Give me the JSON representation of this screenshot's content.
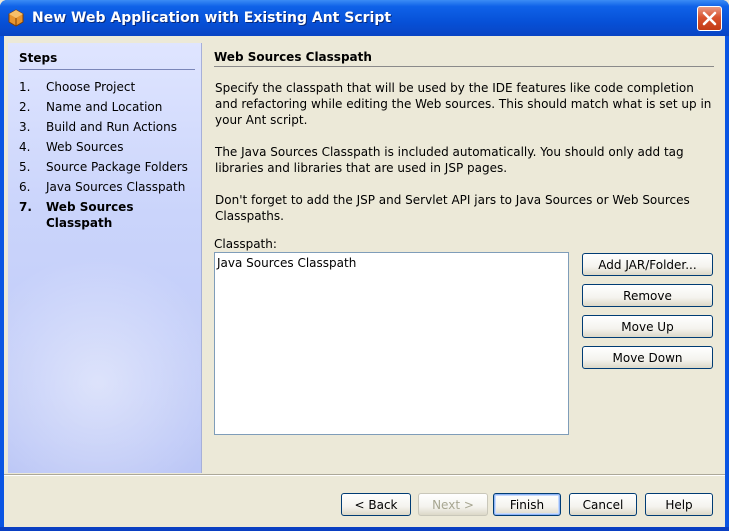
{
  "window": {
    "title": "New Web Application with Existing Ant Script",
    "icon": "netbeans-project-icon",
    "close_icon": "close-icon"
  },
  "steps": {
    "title": "Steps",
    "items": [
      {
        "num": "1.",
        "label": "Choose Project"
      },
      {
        "num": "2.",
        "label": "Name and Location"
      },
      {
        "num": "3.",
        "label": "Build and Run Actions"
      },
      {
        "num": "4.",
        "label": "Web Sources"
      },
      {
        "num": "5.",
        "label": "Source Package Folders"
      },
      {
        "num": "6.",
        "label": "Java Sources Classpath"
      },
      {
        "num": "7.",
        "label": "Web Sources Classpath"
      }
    ]
  },
  "content": {
    "title": "Web Sources Classpath",
    "paragraph1": "Specify the classpath that will be used by the IDE features like code completion and refactoring while editing the Web sources. This should match what is set up in your Ant script.",
    "paragraph2": "The Java Sources Classpath is included automatically. You should only add tag libraries and libraries that are used in JSP pages.",
    "paragraph3": "Don't forget to add the JSP and Servlet API jars to Java Sources or Web Sources Classpaths.",
    "classpath_label": "Classpath:",
    "classpath_items": [
      "Java Sources Classpath"
    ]
  },
  "side_buttons": {
    "add": "Add JAR/Folder...",
    "remove": "Remove",
    "move_up": "Move Up",
    "move_down": "Move Down"
  },
  "footer_buttons": {
    "back": "< Back",
    "next": "Next >",
    "finish": "Finish",
    "cancel": "Cancel",
    "help": "Help"
  },
  "colors": {
    "titlebar": "#0751d8",
    "steps_panel": "#cad4fb",
    "dialog_bg": "#ece9d8",
    "close_button": "#d9532d"
  }
}
